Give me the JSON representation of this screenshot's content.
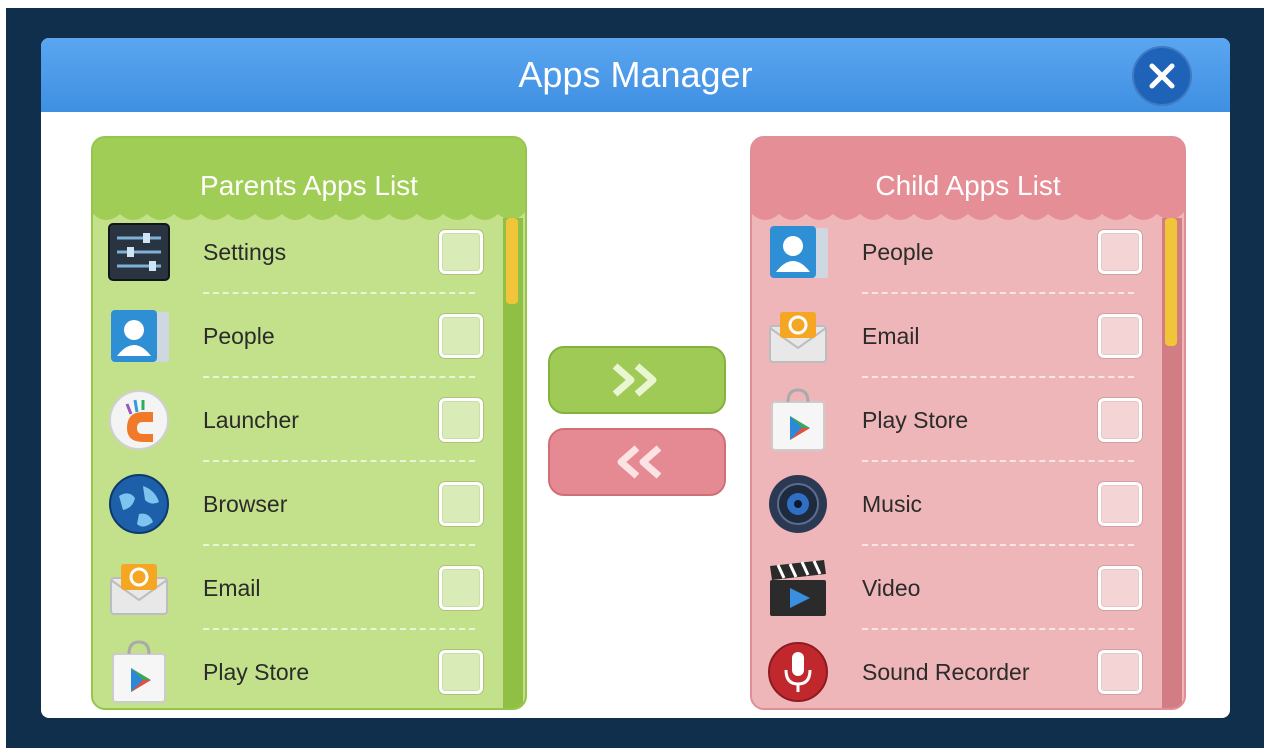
{
  "dialog": {
    "title": "Apps Manager",
    "close_icon": "close-icon"
  },
  "parents": {
    "title": "Parents Apps List",
    "items": [
      {
        "label": "Settings",
        "icon": "settings-icon",
        "checked": false
      },
      {
        "label": "People",
        "icon": "people-icon",
        "checked": false
      },
      {
        "label": "Launcher",
        "icon": "launcher-icon",
        "checked": false
      },
      {
        "label": "Browser",
        "icon": "browser-icon",
        "checked": false
      },
      {
        "label": "Email",
        "icon": "email-icon",
        "checked": false
      },
      {
        "label": "Play Store",
        "icon": "play-store-icon",
        "checked": false
      }
    ]
  },
  "child": {
    "title": "Child Apps List",
    "items": [
      {
        "label": "People",
        "icon": "people-icon",
        "checked": false
      },
      {
        "label": "Email",
        "icon": "email-icon",
        "checked": false
      },
      {
        "label": "Play Store",
        "icon": "play-store-icon",
        "checked": false
      },
      {
        "label": "Music",
        "icon": "music-icon",
        "checked": false
      },
      {
        "label": "Video",
        "icon": "video-icon",
        "checked": false
      },
      {
        "label": "Sound Recorder",
        "icon": "sound-recorder-icon",
        "checked": false
      }
    ]
  },
  "controls": {
    "move_to_child_icon": "double-chevron-right-icon",
    "move_to_parent_icon": "double-chevron-left-icon"
  },
  "colors": {
    "title_bar": "#4a9aea",
    "parents_panel": "#c3e08b",
    "parents_header": "#9fcd55",
    "child_panel": "#efb6b9",
    "child_header": "#e68e96",
    "scroll_thumb": "#f0c53a",
    "backdrop": "#0f2f4c"
  }
}
